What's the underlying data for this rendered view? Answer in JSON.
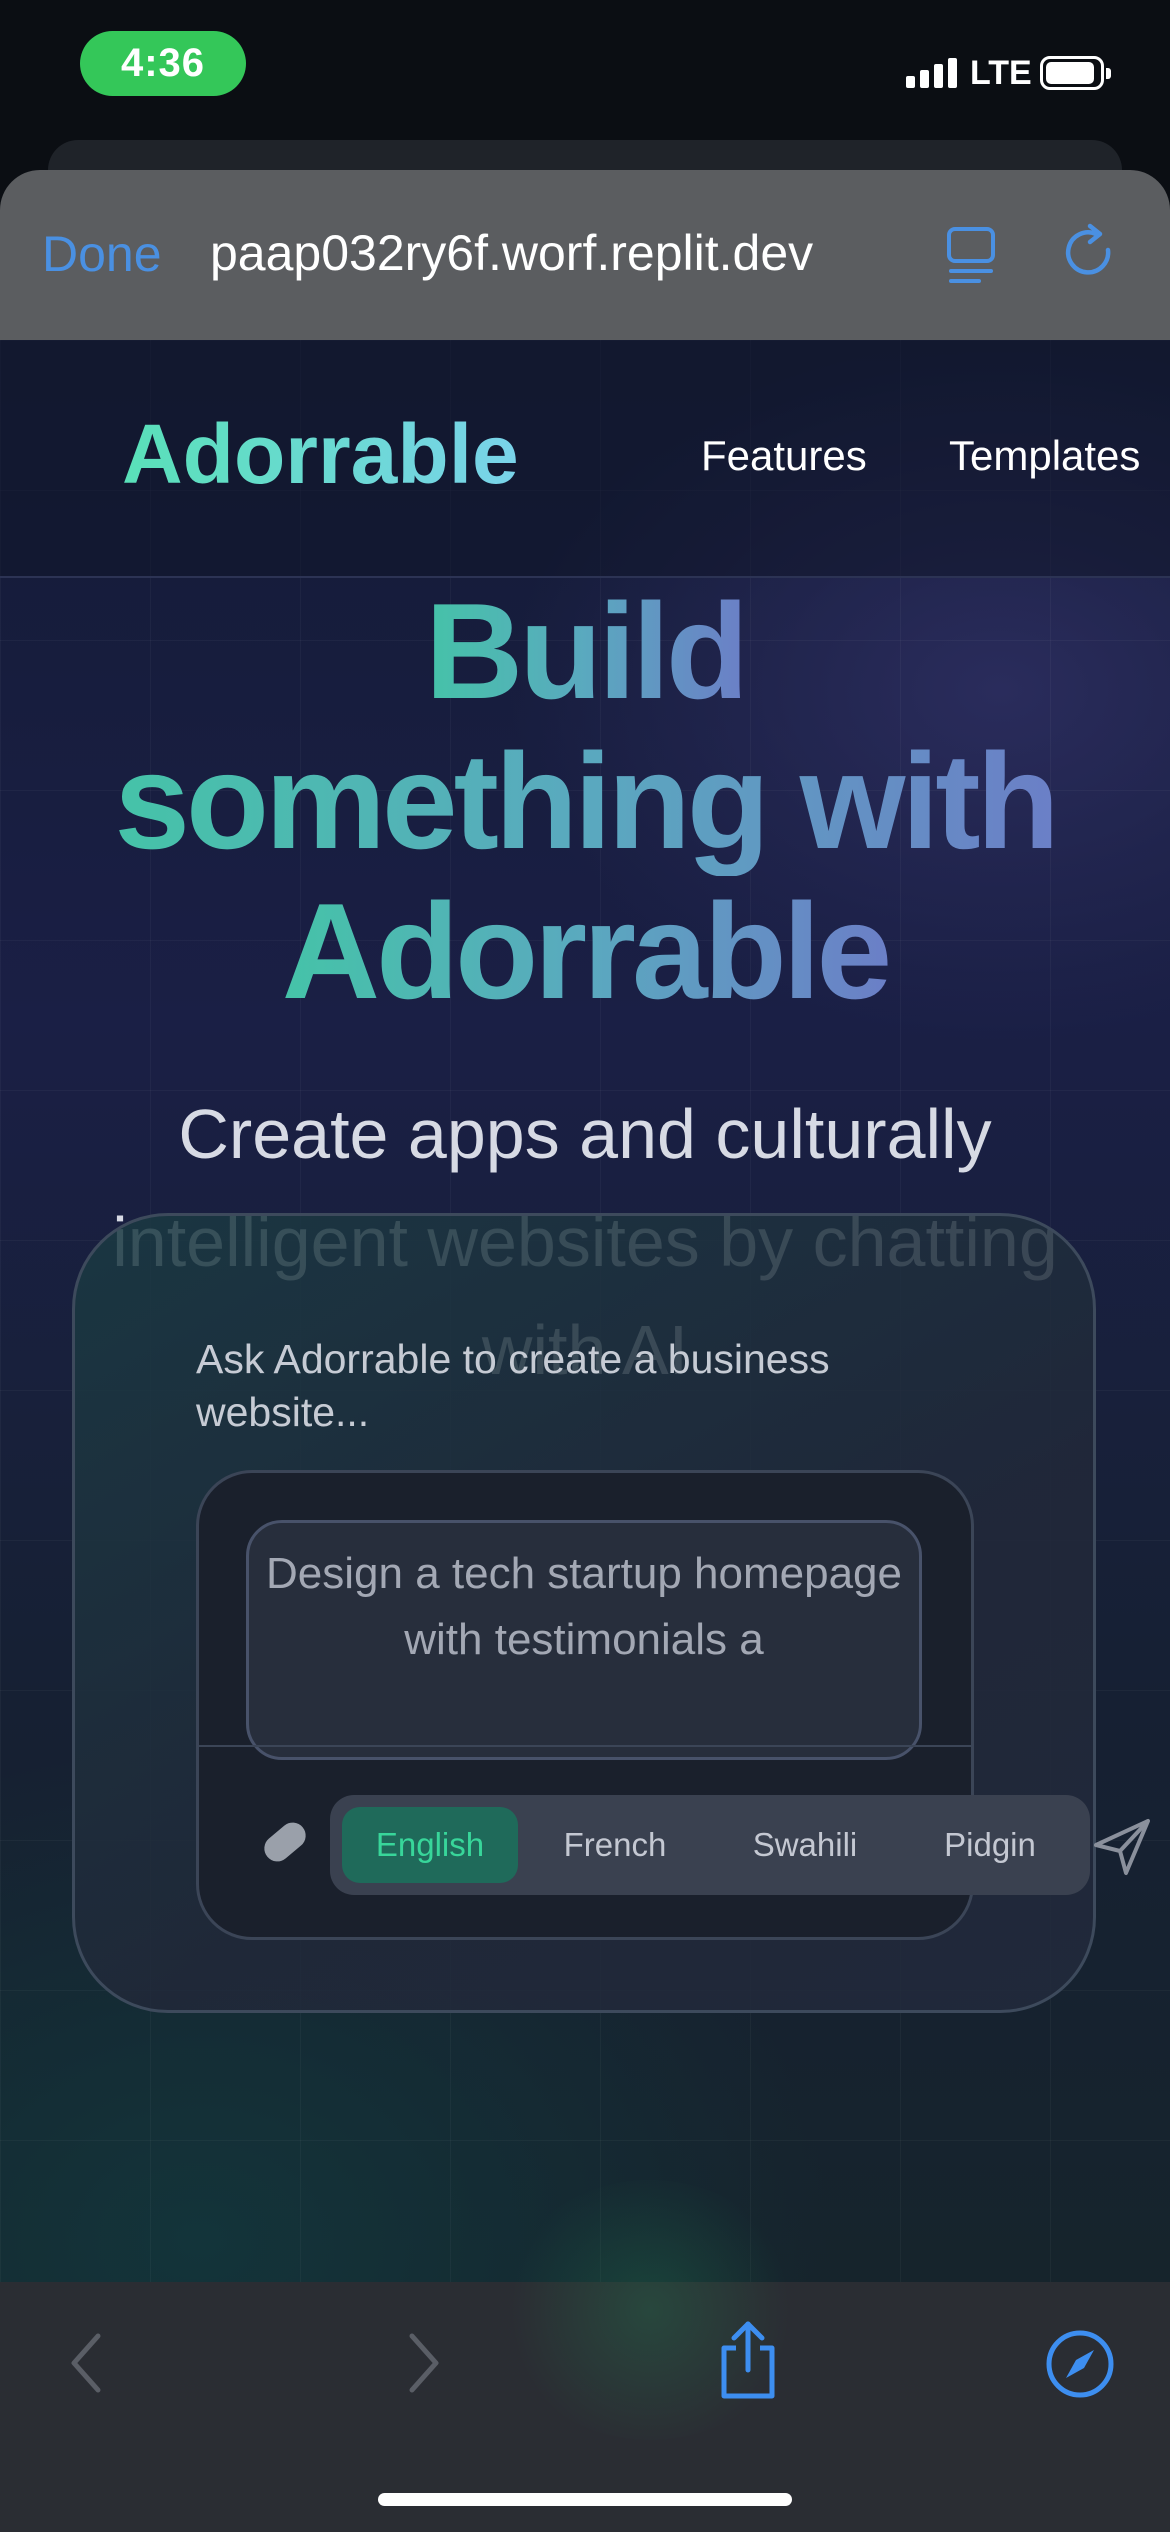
{
  "status_bar": {
    "time": "4:36",
    "network": "LTE"
  },
  "browser": {
    "done_label": "Done",
    "url": "paap032ry6f.worf.replit.dev",
    "icons": [
      "reader-mode-icon",
      "reload-icon",
      "back-icon",
      "forward-icon",
      "share-icon",
      "compass-icon"
    ]
  },
  "nav": {
    "brand": "Adorrable",
    "links": [
      "Features",
      "Templates"
    ]
  },
  "hero": {
    "title_lines": [
      "Build",
      "something with",
      "Adorrable"
    ],
    "subtitle": "Create apps and culturally intelligent websites by chatting with AI"
  },
  "prompt_card": {
    "label": "Ask Adorrable to create a business website...",
    "placeholder": "Design a tech startup homepage with testimonials a",
    "languages": [
      "English",
      "French",
      "Swahili",
      "Pidgin"
    ],
    "selected_language": "English"
  },
  "colors": {
    "accent": "#4a90e2",
    "brand_green": "#59e0b8",
    "active_lang_bg": "#1f6a5a",
    "active_lang_text": "#38d69a"
  }
}
